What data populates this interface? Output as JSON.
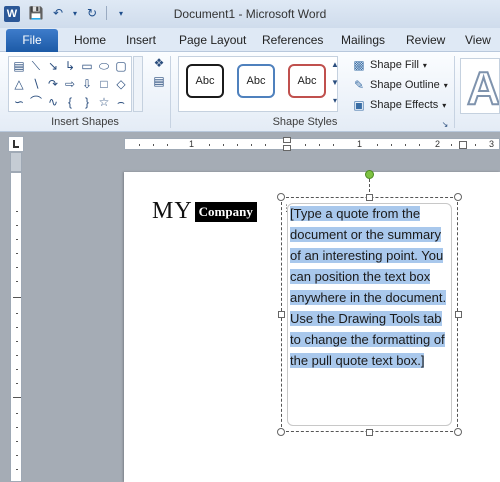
{
  "window": {
    "title": "Document1  -  Microsoft Word"
  },
  "quick_access": {
    "save_icon": "save-icon",
    "undo_icon": "undo-icon",
    "redo_icon": "redo-icon"
  },
  "tabs": {
    "file": "File",
    "items": [
      "Home",
      "Insert",
      "Page Layout",
      "References",
      "Mailings",
      "Review",
      "View"
    ]
  },
  "ribbon": {
    "insert_shapes_label": "Insert Shapes",
    "shape_styles_label": "Shape Styles",
    "style_samples": [
      "Abc",
      "Abc",
      "Abc"
    ],
    "style_colors": [
      "#1b1b1b",
      "#4f81bd",
      "#c0504d"
    ],
    "shape_fill": "Shape Fill",
    "shape_outline": "Shape Outline",
    "shape_effects": "Shape Effects",
    "wordart_letter": "A"
  },
  "ruler": {
    "numbers": [
      "1",
      "1",
      "2",
      "3"
    ]
  },
  "document": {
    "logo_my": "MY",
    "logo_company": "Company",
    "pull_quote": "[Type a quote from the document or the summary of an interesting point. You can position the text box anywhere in the document. Use the Drawing Tools tab to change the formatting of the pull quote text box.]"
  },
  "colors": {
    "file_tab": "#2a67b4",
    "selection": "#a9c8ec",
    "rotate_handle": "#7ec242"
  }
}
